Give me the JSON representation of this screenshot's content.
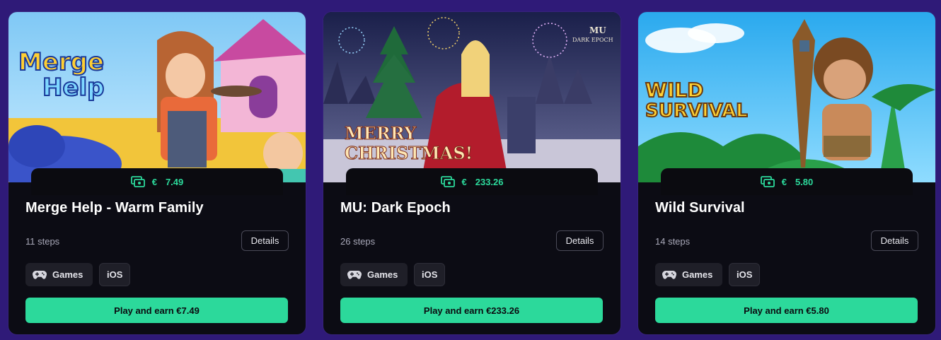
{
  "cards": [
    {
      "title": "Merge Help - Warm Family",
      "reward_currency": "€",
      "reward_amount": "7.49",
      "steps": "11 steps",
      "details_label": "Details",
      "tags": [
        "Games",
        "iOS"
      ],
      "cta": "Play and earn €7.49",
      "logo_text": [
        "Merge",
        "Help"
      ]
    },
    {
      "title": "MU: Dark Epoch",
      "reward_currency": "€",
      "reward_amount": "233.26",
      "steps": "26 steps",
      "details_label": "Details",
      "tags": [
        "Games",
        "iOS"
      ],
      "cta": "Play and earn €233.26",
      "logo_text": [
        "MU",
        "DARK EPOCH"
      ],
      "banner_text": [
        "MERRY",
        "CHRISTMAS!"
      ]
    },
    {
      "title": "Wild Survival",
      "reward_currency": "€",
      "reward_amount": "5.80",
      "steps": "14 steps",
      "details_label": "Details",
      "tags": [
        "Games",
        "iOS"
      ],
      "cta": "Play and earn €5.80",
      "logo_text": [
        "WILD",
        "SURVIVAL"
      ]
    }
  ],
  "colors": {
    "page_bg": "#2f1a78",
    "card_bg": "#0c0c14",
    "accent": "#2cd99b"
  }
}
